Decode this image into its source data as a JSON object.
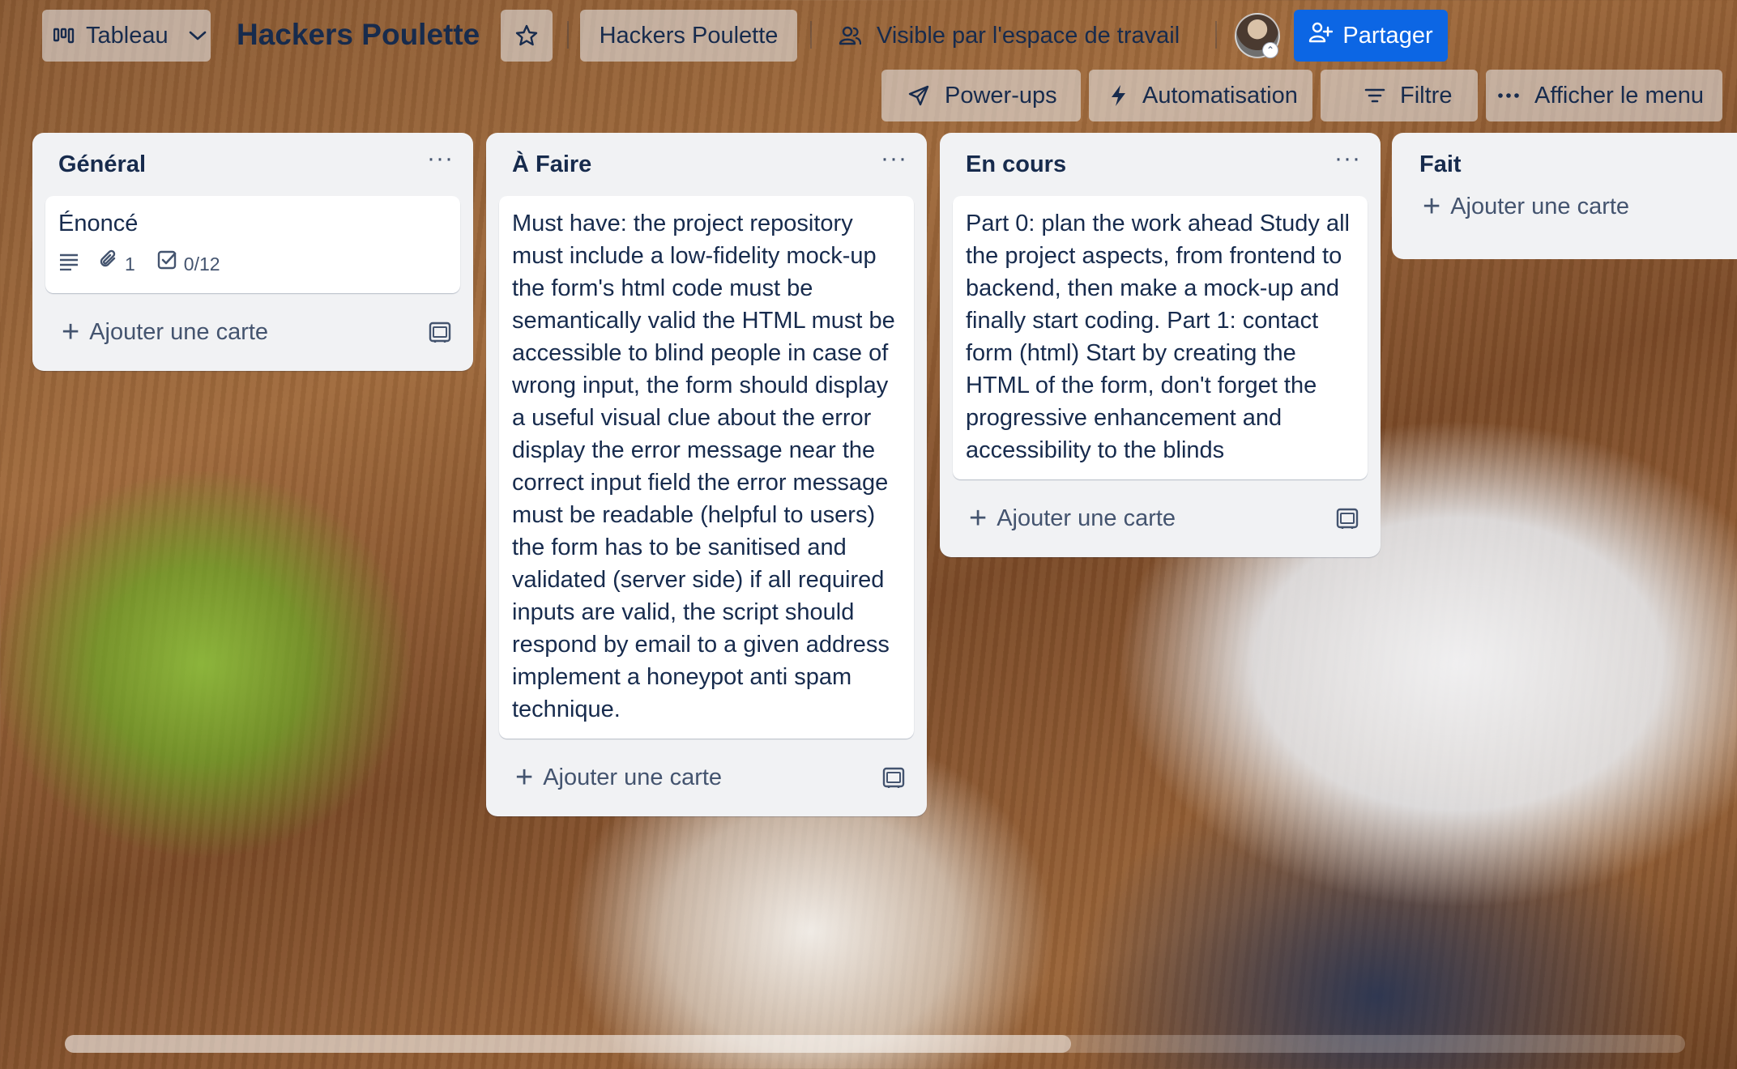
{
  "header": {
    "view_switcher_label": "Tableau",
    "board_title": "Hackers Poulette",
    "workspace_label": "Hackers Poulette",
    "visibility_label": "Visible par l'espace de travail",
    "share_label": "Partager",
    "powerups_label": "Power-ups",
    "automation_label": "Automatisation",
    "filter_label": "Filtre",
    "show_menu_label": "Afficher le menu"
  },
  "lists": [
    {
      "title": "Général",
      "cards": [
        {
          "title": "Énoncé",
          "attachments": "1",
          "checklist": "0/12"
        }
      ],
      "add_card_label": "Ajouter une carte"
    },
    {
      "title": "À Faire",
      "cards": [
        {
          "text": "Must have: the project repository must include a low-fidelity mock-up the form's html code must be semantically valid the HTML must be accessible to blind people in case of wrong input, the form should display a useful visual clue about the error display the error message near the correct input field the error message must be readable (helpful to users) the form has to be sanitised and validated (server side) if all required inputs are valid, the script should respond by email to a given address implement a honeypot anti spam technique."
        }
      ],
      "add_card_label": "Ajouter une carte"
    },
    {
      "title": "En cours",
      "cards": [
        {
          "text": "Part 0: plan the work ahead Study all the project aspects, from frontend to backend, then make a mock-up and finally start coding. Part 1: contact form (html) Start by creating the HTML of the form, don't forget the progressive enhancement and accessibility to the blinds"
        }
      ],
      "add_card_label": "Ajouter une carte"
    },
    {
      "title": "Fait",
      "cards": [],
      "add_card_label": "Ajouter une carte"
    }
  ],
  "colors": {
    "share_button": "#0c66e4",
    "list_background": "#f1f2f4",
    "text_primary": "#172b4d",
    "text_secondary": "#44546f"
  }
}
